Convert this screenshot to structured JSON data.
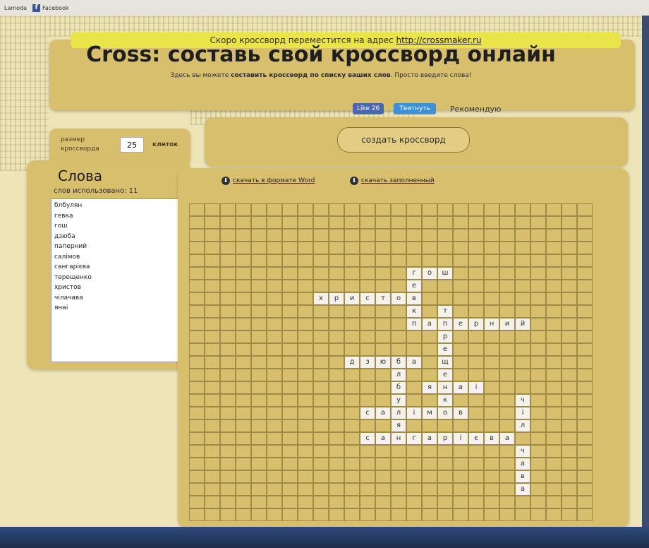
{
  "bookmarks": {
    "item1": "Lamoda",
    "item2": "Facebook",
    "fb_glyph": "f"
  },
  "notice": {
    "text": "Скоро кроссворд переместится на адрес ",
    "url": "http://crossmaker.ru"
  },
  "header": {
    "title": "Cross: составь свой кроссворд онлайн",
    "subtitle_a": "Здесь вы можете ",
    "subtitle_b": "составить кроссворд по списку ваших слов",
    "subtitle_c": ". Просто введите слова!"
  },
  "social": {
    "like": "Like 26",
    "tweet": "Твитнуть",
    "recommend": "Рекомендую"
  },
  "size": {
    "label": "размер кроссворда",
    "value": "25",
    "unit": "клеток"
  },
  "create_button": "создать кроссворд",
  "words": {
    "heading": "Слова",
    "used": "слов использовано: 11",
    "list": [
      "блбулян",
      "гевка",
      "гош",
      "дзюба",
      "паперний",
      "салімов",
      "сангарієва",
      "терещенко",
      "христов",
      "чілачава",
      "янаі"
    ]
  },
  "downloads": {
    "word": "скачать в формате Word",
    "filled": "скачать заполненный"
  },
  "grid": {
    "cols": 26,
    "rows": 25,
    "cells": [
      [
        5,
        14,
        "г"
      ],
      [
        5,
        15,
        "о"
      ],
      [
        5,
        16,
        "ш"
      ],
      [
        6,
        14,
        "е"
      ],
      [
        7,
        8,
        "х"
      ],
      [
        7,
        9,
        "р"
      ],
      [
        7,
        10,
        "и"
      ],
      [
        7,
        11,
        "с"
      ],
      [
        7,
        12,
        "т"
      ],
      [
        7,
        13,
        "о"
      ],
      [
        7,
        14,
        "в"
      ],
      [
        8,
        14,
        "к"
      ],
      [
        8,
        16,
        "т"
      ],
      [
        9,
        14,
        "п"
      ],
      [
        9,
        15,
        "а"
      ],
      [
        9,
        16,
        "п"
      ],
      [
        9,
        17,
        "е"
      ],
      [
        9,
        18,
        "р"
      ],
      [
        9,
        19,
        "н"
      ],
      [
        9,
        20,
        "и"
      ],
      [
        9,
        21,
        "й"
      ],
      [
        10,
        16,
        "р"
      ],
      [
        11,
        16,
        "е"
      ],
      [
        12,
        10,
        "д"
      ],
      [
        12,
        11,
        "з"
      ],
      [
        12,
        12,
        "ю"
      ],
      [
        12,
        13,
        "б"
      ],
      [
        12,
        14,
        "а"
      ],
      [
        12,
        16,
        "щ"
      ],
      [
        13,
        13,
        "л"
      ],
      [
        13,
        16,
        "е"
      ],
      [
        14,
        13,
        "б"
      ],
      [
        14,
        15,
        "я"
      ],
      [
        14,
        16,
        "н"
      ],
      [
        14,
        17,
        "а"
      ],
      [
        14,
        18,
        "і"
      ],
      [
        15,
        13,
        "у"
      ],
      [
        15,
        16,
        "к"
      ],
      [
        15,
        21,
        "ч"
      ],
      [
        16,
        11,
        "с"
      ],
      [
        16,
        12,
        "а"
      ],
      [
        16,
        13,
        "л"
      ],
      [
        16,
        14,
        "і"
      ],
      [
        16,
        15,
        "м"
      ],
      [
        16,
        16,
        "о"
      ],
      [
        16,
        17,
        "в"
      ],
      [
        16,
        21,
        "і"
      ],
      [
        17,
        13,
        "я"
      ],
      [
        17,
        21,
        "л"
      ],
      [
        18,
        11,
        "с"
      ],
      [
        18,
        12,
        "а"
      ],
      [
        18,
        13,
        "н"
      ],
      [
        18,
        14,
        "г"
      ],
      [
        18,
        15,
        "а"
      ],
      [
        18,
        16,
        "р"
      ],
      [
        18,
        17,
        "і"
      ],
      [
        18,
        18,
        "є"
      ],
      [
        18,
        19,
        "в"
      ],
      [
        18,
        20,
        "а"
      ],
      [
        19,
        21,
        "ч"
      ],
      [
        20,
        21,
        "а"
      ],
      [
        21,
        21,
        "в"
      ],
      [
        22,
        21,
        "а"
      ]
    ]
  }
}
